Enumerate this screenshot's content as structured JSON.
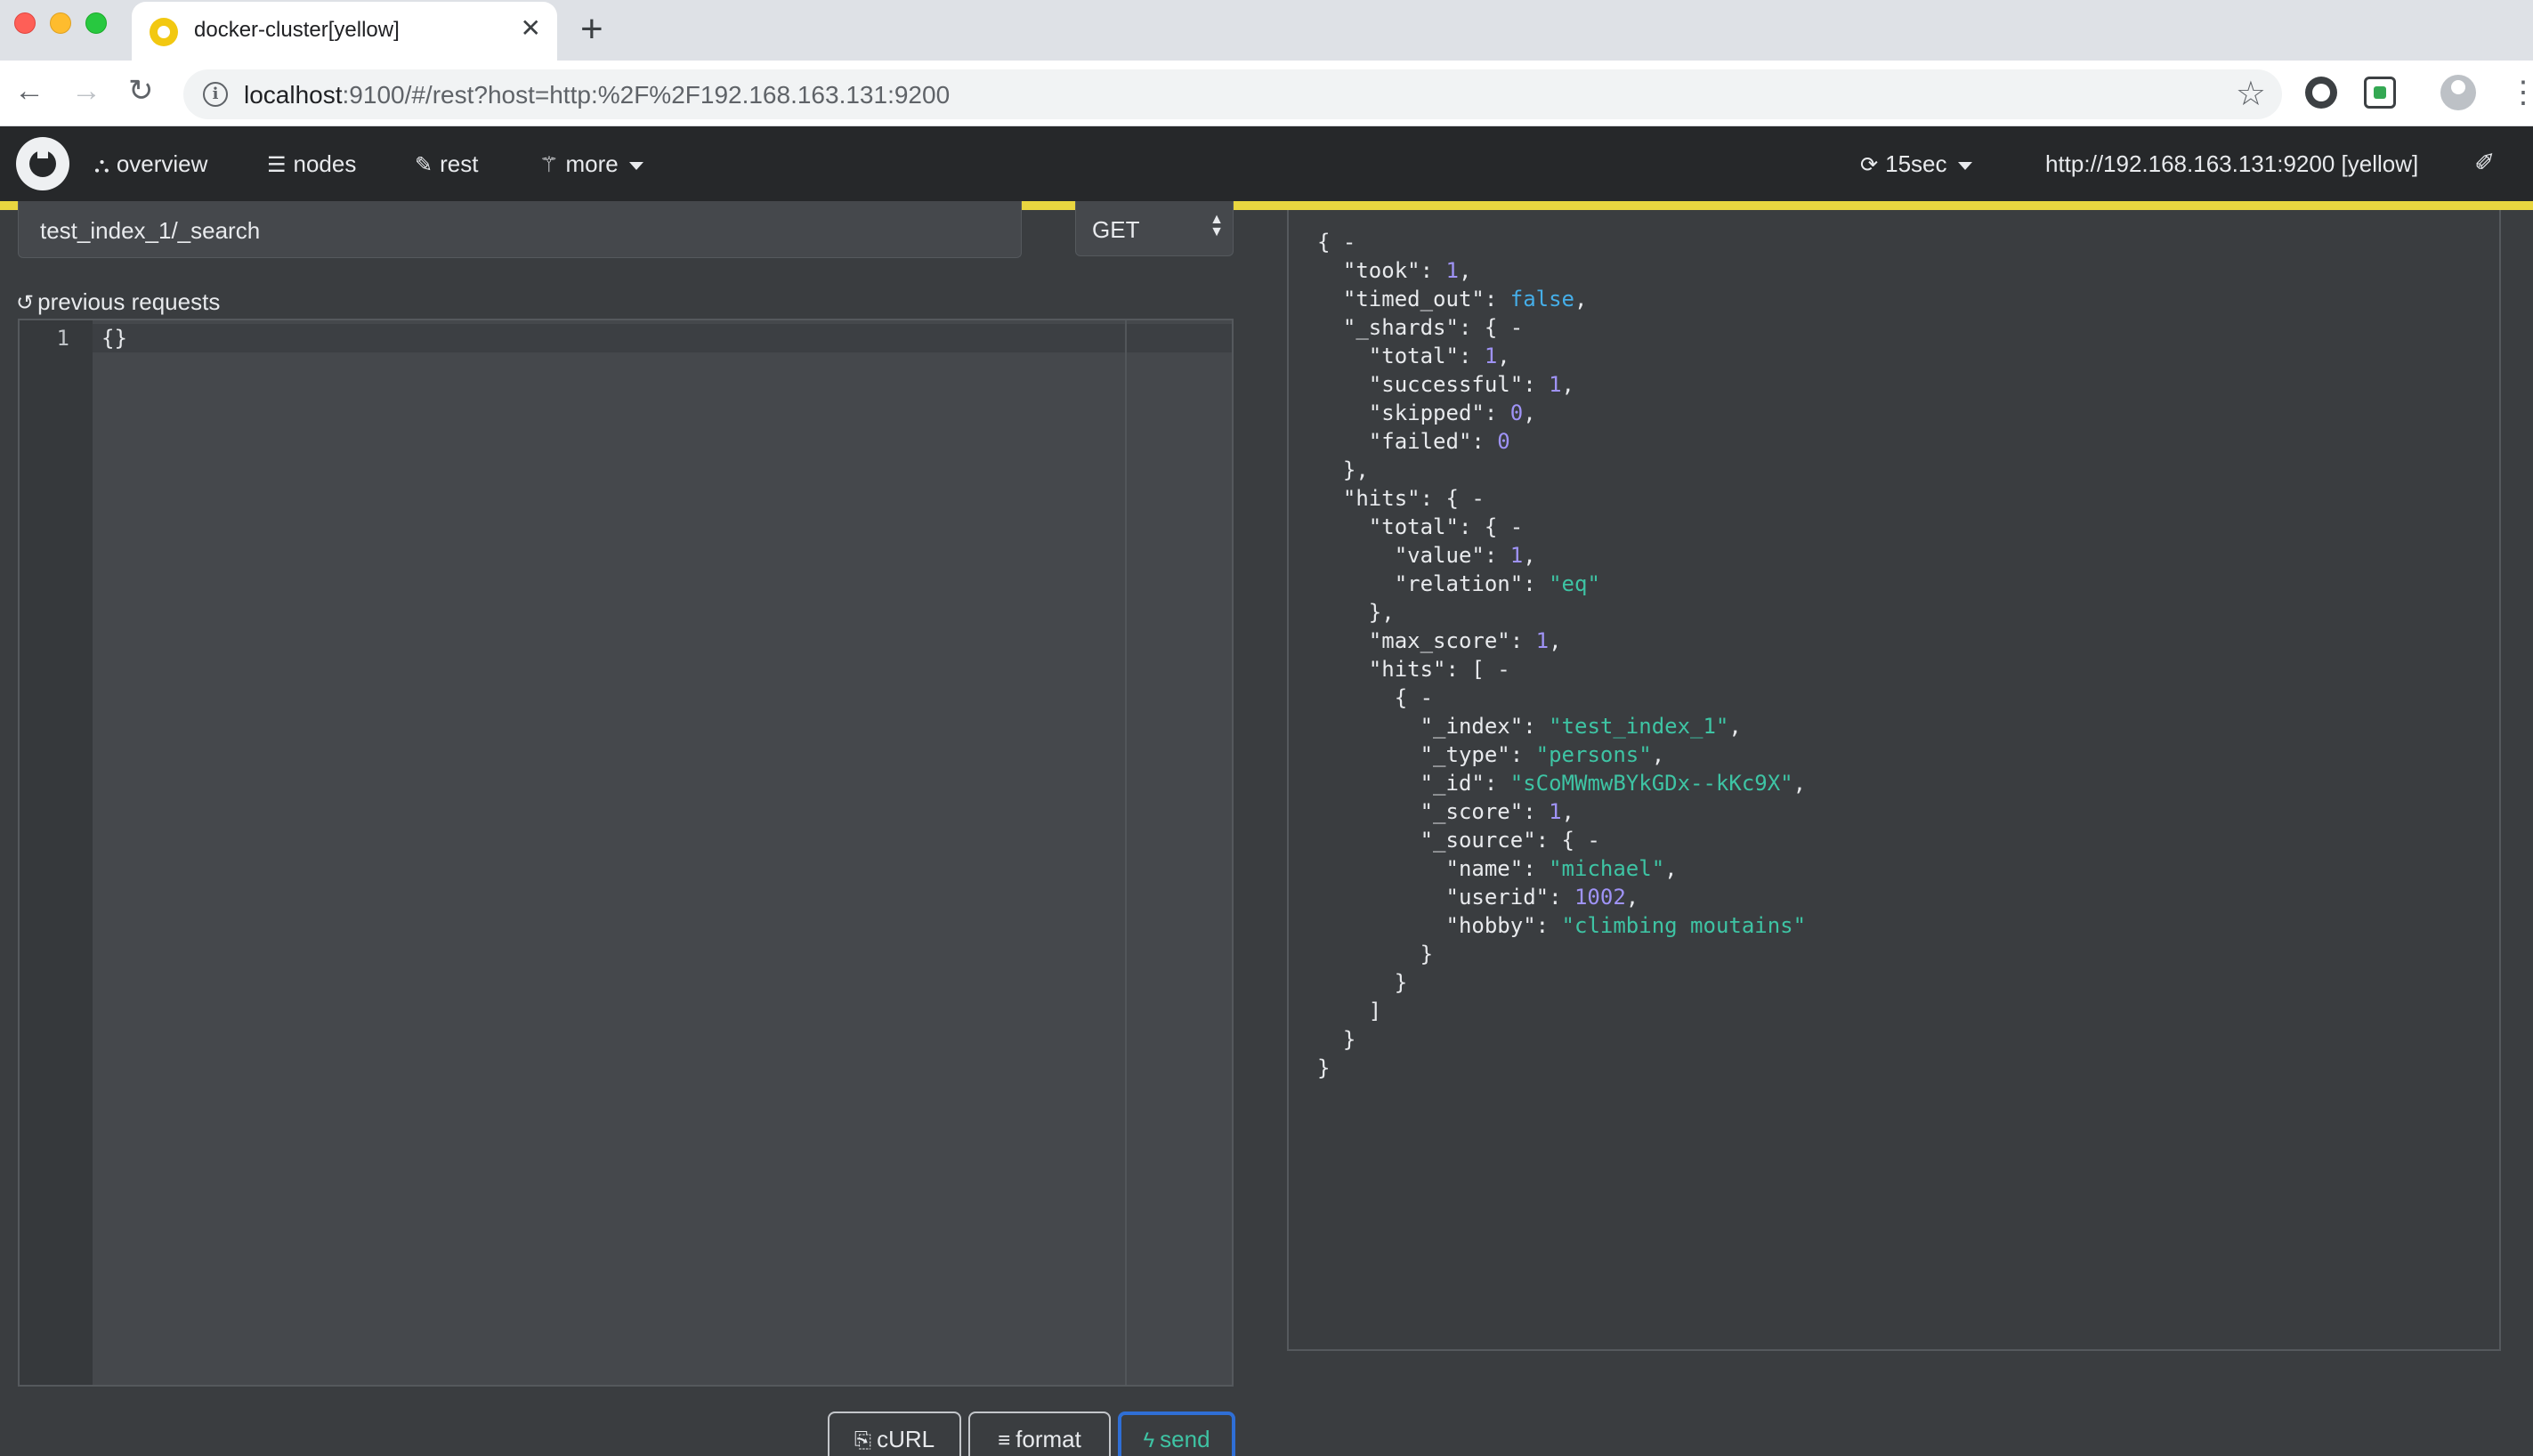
{
  "browser": {
    "tab_title": "docker-cluster[yellow]",
    "tab_close": "✕",
    "new_tab": "+",
    "url_host": "localhost",
    "url_rest": ":9100/#/rest?host=http:%2F%2F192.168.163.131:9200"
  },
  "app": {
    "nav": {
      "overview": "overview",
      "nodes": "nodes",
      "rest": "rest",
      "more": "more"
    },
    "refresh_interval": "15sec",
    "cluster_url": "http://192.168.163.131:9200 [yellow]",
    "status_color": "#e9d640"
  },
  "request": {
    "path": "test_index_1/_search",
    "method": "GET",
    "previous_requests_label": "previous requests",
    "line_number": "1",
    "body": "{}"
  },
  "buttons": {
    "curl": "cURL",
    "format": "format",
    "send": "send"
  },
  "response": {
    "took": "1",
    "timed_out": "false",
    "shards_total": "1",
    "shards_successful": "1",
    "shards_skipped": "0",
    "shards_failed": "0",
    "hits_total_value": "1",
    "hits_total_relation": "\"eq\"",
    "max_score": "1",
    "hit_index": "\"test_index_1\"",
    "hit_type": "\"persons\"",
    "hit_id": "\"sCoMWmwBYkGDx--kKc9X\"",
    "hit_score": "1",
    "source_name": "\"michael\"",
    "source_userid": "1002",
    "source_hobby": "\"climbing moutains\""
  }
}
